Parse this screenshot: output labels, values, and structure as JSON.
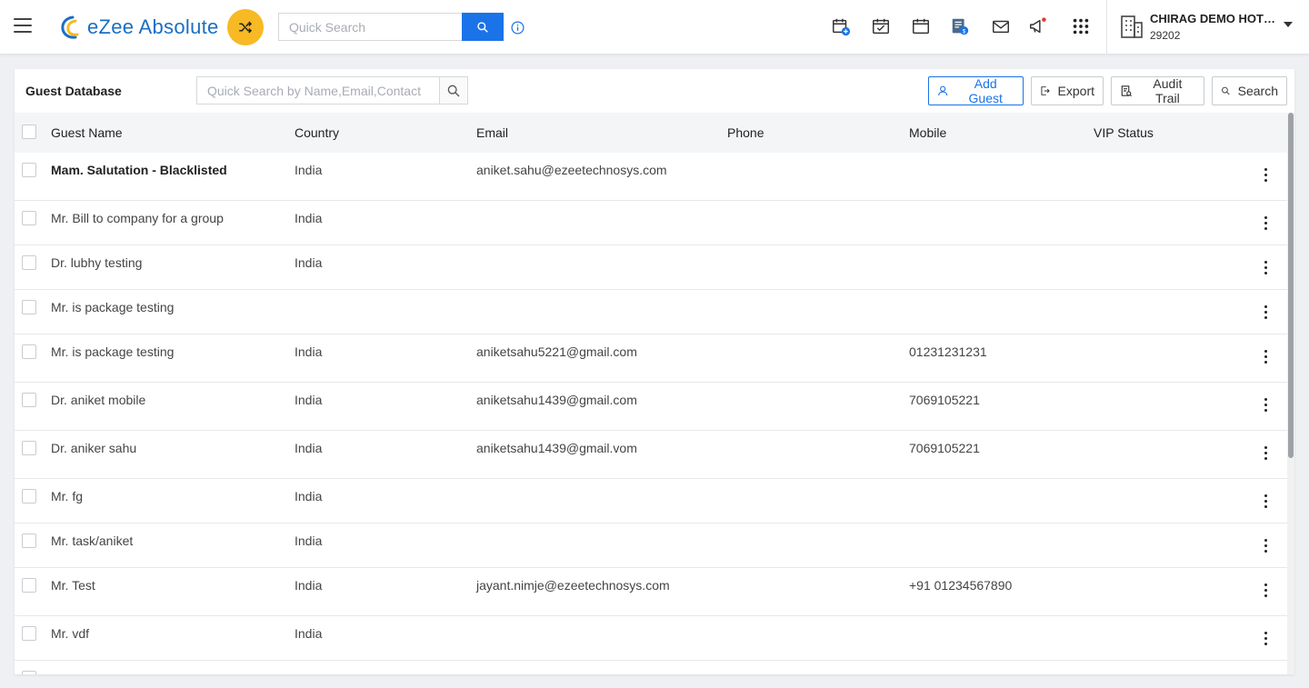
{
  "app": {
    "name": "eZee Absolute",
    "search_placeholder": "Quick Search",
    "hotel_name": "CHIRAG DEMO HOTEL",
    "hotel_id": "29202",
    "brand_color": "#1a73e8",
    "accent_color": "#f7b924"
  },
  "topbar_icons": [
    "menu-icon",
    "shuffle-icon",
    "search-icon",
    "info-icon",
    "calendar-add-icon",
    "calendar-check-icon",
    "calendar-icon",
    "billing-icon",
    "mail-icon",
    "announcement-icon",
    "apps-grid-icon",
    "hotel-building-icon",
    "chevron-down-icon"
  ],
  "page": {
    "title": "Guest Database",
    "search_placeholder": "Quick Search by Name,Email,Contact",
    "add_guest": "Add Guest",
    "export": "Export",
    "audit_trail": "Audit Trail",
    "search": "Search"
  },
  "table": {
    "columns": [
      "Guest Name",
      "Country",
      "Email",
      "Phone",
      "Mobile",
      "VIP Status"
    ],
    "rows": [
      {
        "name": "Mam. Salutation - Blacklisted",
        "country": "India",
        "email": "aniket.sahu@ezeetechnosys.com",
        "phone": "",
        "mobile": "",
        "vip": ""
      },
      {
        "name": "Mr. Bill to company for a group",
        "country": "India",
        "email": "",
        "phone": "",
        "mobile": "",
        "vip": ""
      },
      {
        "name": "Dr. lubhy testing",
        "country": "India",
        "email": "",
        "phone": "",
        "mobile": "",
        "vip": ""
      },
      {
        "name": "Mr. is package testing",
        "country": "",
        "email": "",
        "phone": "",
        "mobile": "",
        "vip": ""
      },
      {
        "name": "Mr. is package testing",
        "country": "India",
        "email": "aniketsahu5221@gmail.com",
        "phone": "",
        "mobile": "01231231231",
        "vip": ""
      },
      {
        "name": "Dr. aniket mobile",
        "country": "India",
        "email": "aniketsahu1439@gmail.com",
        "phone": "",
        "mobile": "7069105221",
        "vip": ""
      },
      {
        "name": "Dr. aniker sahu",
        "country": "India",
        "email": "aniketsahu1439@gmail.vom",
        "phone": "",
        "mobile": "7069105221",
        "vip": ""
      },
      {
        "name": "Mr. fg",
        "country": "India",
        "email": "",
        "phone": "",
        "mobile": "",
        "vip": ""
      },
      {
        "name": "Mr. task/aniket",
        "country": "India",
        "email": "",
        "phone": "",
        "mobile": "",
        "vip": ""
      },
      {
        "name": "Mr. Test",
        "country": "India",
        "email": "jayant.nimje@ezeetechnosys.com",
        "phone": "",
        "mobile": "+91 01234567890",
        "vip": ""
      },
      {
        "name": "Mr. vdf",
        "country": "India",
        "email": "",
        "phone": "",
        "mobile": "",
        "vip": ""
      }
    ]
  }
}
